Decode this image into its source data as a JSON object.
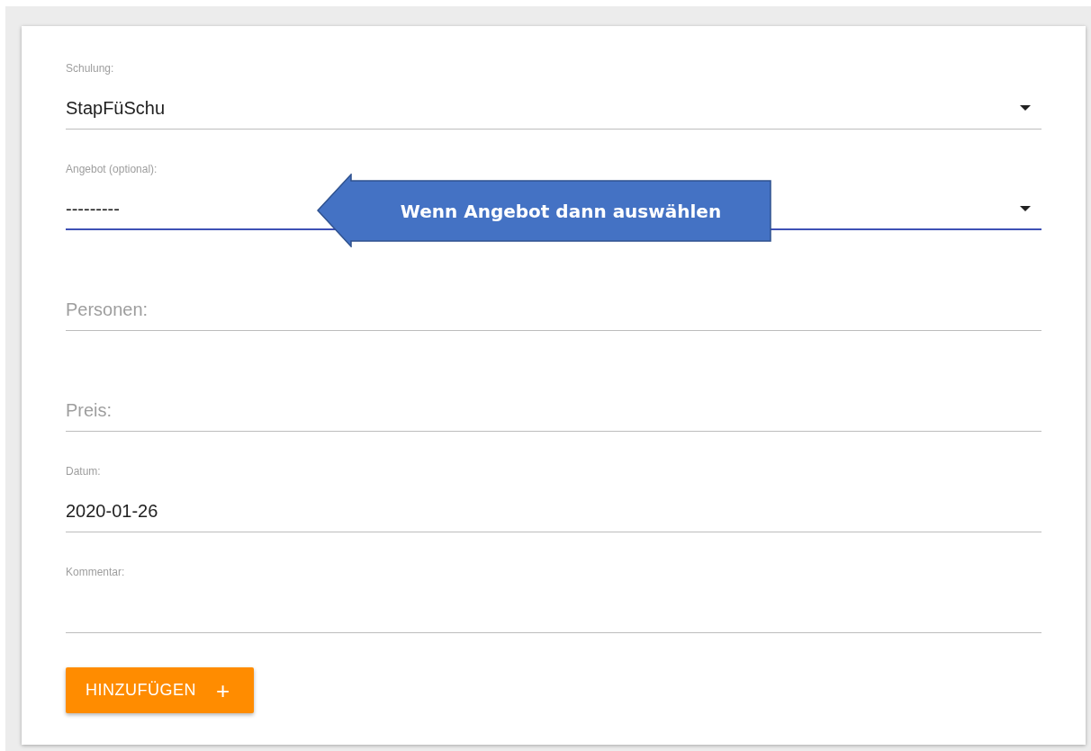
{
  "fields": [
    {
      "kind": "select",
      "label": "Schulung:",
      "value": "StapFüSchu",
      "focused": false
    },
    {
      "kind": "select",
      "label": "Angebot (optional):",
      "value": "---------",
      "focused": true
    },
    {
      "kind": "text",
      "placeholder": "Personen:",
      "focused": false
    },
    {
      "kind": "text",
      "placeholder": "Preis:",
      "focused": false
    },
    {
      "kind": "text",
      "label": "Datum:",
      "value": "2020-01-26",
      "focused": false
    },
    {
      "kind": "textarea",
      "label": "Kommentar:",
      "focused": false
    }
  ],
  "button": {
    "label": "HINZUFÜGEN",
    "icon": "+"
  },
  "callout": {
    "text": "Wenn Angebot dann auswählen"
  }
}
